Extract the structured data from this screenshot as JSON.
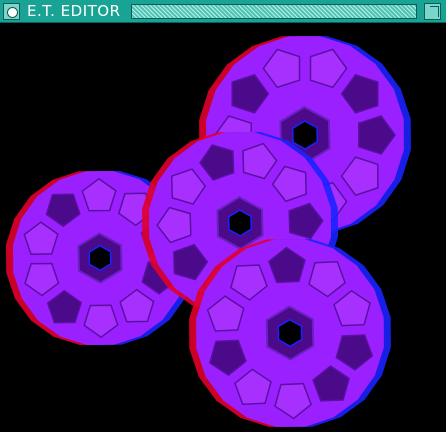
{
  "window": {
    "title": "E.T. EDITOR",
    "titlebar_color": "#19a394",
    "icons": [
      "window-menu-icon",
      "maximize-icon"
    ]
  },
  "scene": {
    "description_colors": {
      "background": "#000000",
      "primary_face": "#9b20ff",
      "shadow_face": "#4a0a8a",
      "anaglyph_red": "#e0002a",
      "anaglyph_blue": "#1a22ff"
    }
  }
}
